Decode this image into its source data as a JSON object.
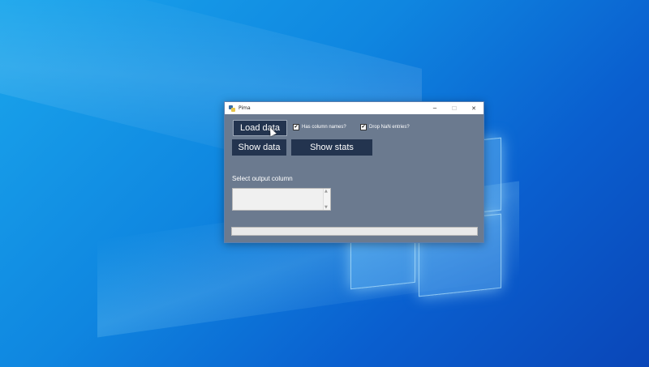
{
  "window": {
    "title": "Pima",
    "minimize_glyph": "─",
    "maximize_glyph": "☐",
    "close_glyph": "✕"
  },
  "buttons": {
    "load_data": "Load data",
    "show_data": "Show data",
    "show_stats": "Show stats"
  },
  "options": {
    "has_column_names": {
      "label": "Has column names?",
      "checked": true,
      "mark": "✔"
    },
    "drop_nan": {
      "label": "Drop NaN entries?",
      "checked": true,
      "mark": "✔"
    }
  },
  "output_column": {
    "label": "Select output column",
    "items": []
  },
  "progress": {
    "value": 0
  },
  "colors": {
    "window_bg": "#6b7a8f",
    "button_bg": "#23344f",
    "desktop_accent": "#0a5fcf"
  },
  "icons": [
    "python-app-icon",
    "minimize-icon",
    "maximize-icon",
    "close-icon",
    "checkbox-checked-icon",
    "scroll-up-icon",
    "scroll-down-icon",
    "mouse-cursor-icon"
  ]
}
